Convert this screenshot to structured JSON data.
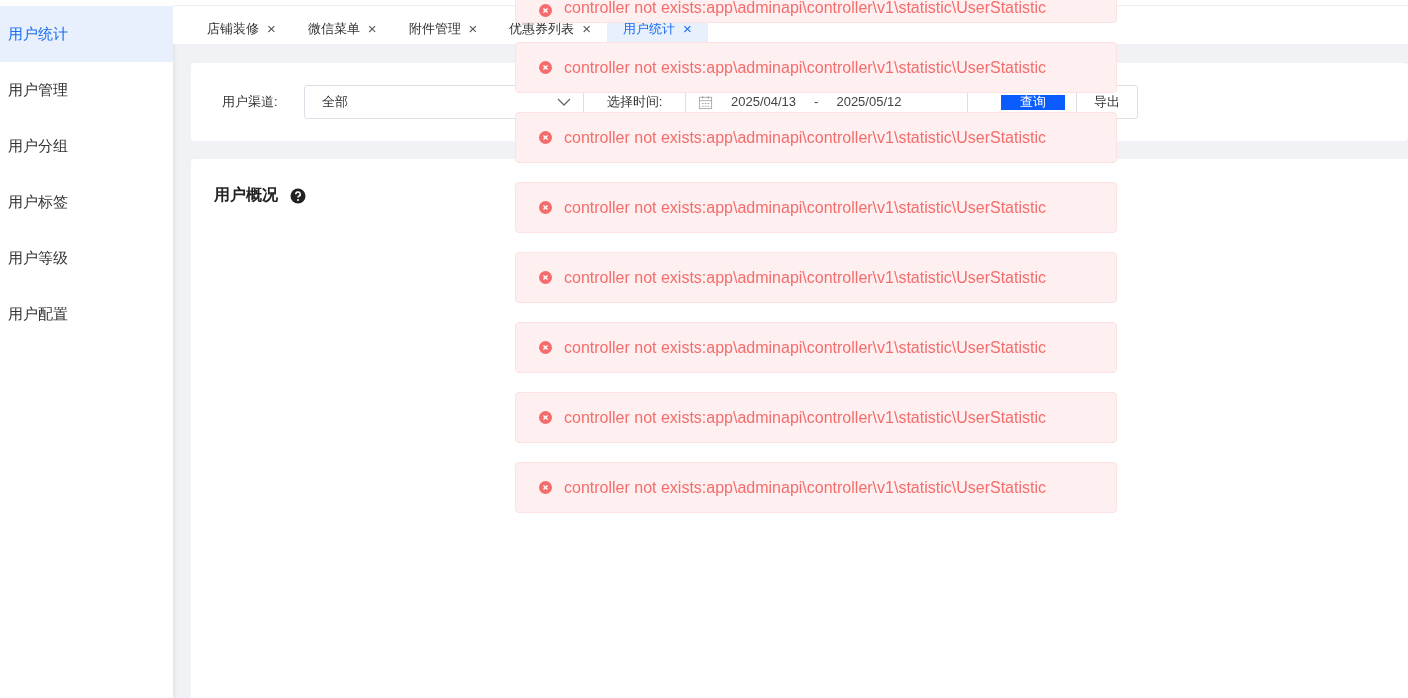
{
  "sidebar": {
    "items": [
      {
        "label": "用户统计",
        "selected": true
      },
      {
        "label": "用户管理",
        "selected": false
      },
      {
        "label": "用户分组",
        "selected": false
      },
      {
        "label": "用户标签",
        "selected": false
      },
      {
        "label": "用户等级",
        "selected": false
      },
      {
        "label": "用户配置",
        "selected": false
      }
    ]
  },
  "tabs": [
    {
      "label": "店铺装修",
      "close": "×",
      "selected": false
    },
    {
      "label": "微信菜单",
      "close": "×",
      "selected": false
    },
    {
      "label": "附件管理",
      "close": "×",
      "selected": false
    },
    {
      "label": "优惠券列表",
      "close": "×",
      "selected": false
    },
    {
      "label": "用户统计",
      "close": "×",
      "selected": true
    }
  ],
  "filter": {
    "channel_label": "用户渠道:",
    "channel_value": "全部",
    "time_label": "选择时间:",
    "date_start": "2025/04/13",
    "date_separator": "-",
    "date_end": "2025/05/12",
    "query_button": "查询",
    "export_button": "导出"
  },
  "overview": {
    "title": "用户概况"
  },
  "toasts": [
    {
      "message": "controller not exists:app\\adminapi\\controller\\v1\\statistic\\UserStatistic"
    },
    {
      "message": "controller not exists:app\\adminapi\\controller\\v1\\statistic\\UserStatistic"
    },
    {
      "message": "controller not exists:app\\adminapi\\controller\\v1\\statistic\\UserStatistic"
    },
    {
      "message": "controller not exists:app\\adminapi\\controller\\v1\\statistic\\UserStatistic"
    },
    {
      "message": "controller not exists:app\\adminapi\\controller\\v1\\statistic\\UserStatistic"
    },
    {
      "message": "controller not exists:app\\adminapi\\controller\\v1\\statistic\\UserStatistic"
    },
    {
      "message": "controller not exists:app\\adminapi\\controller\\v1\\statistic\\UserStatistic"
    },
    {
      "message": "controller not exists:app\\adminapi\\controller\\v1\\statistic\\UserStatistic"
    }
  ]
}
